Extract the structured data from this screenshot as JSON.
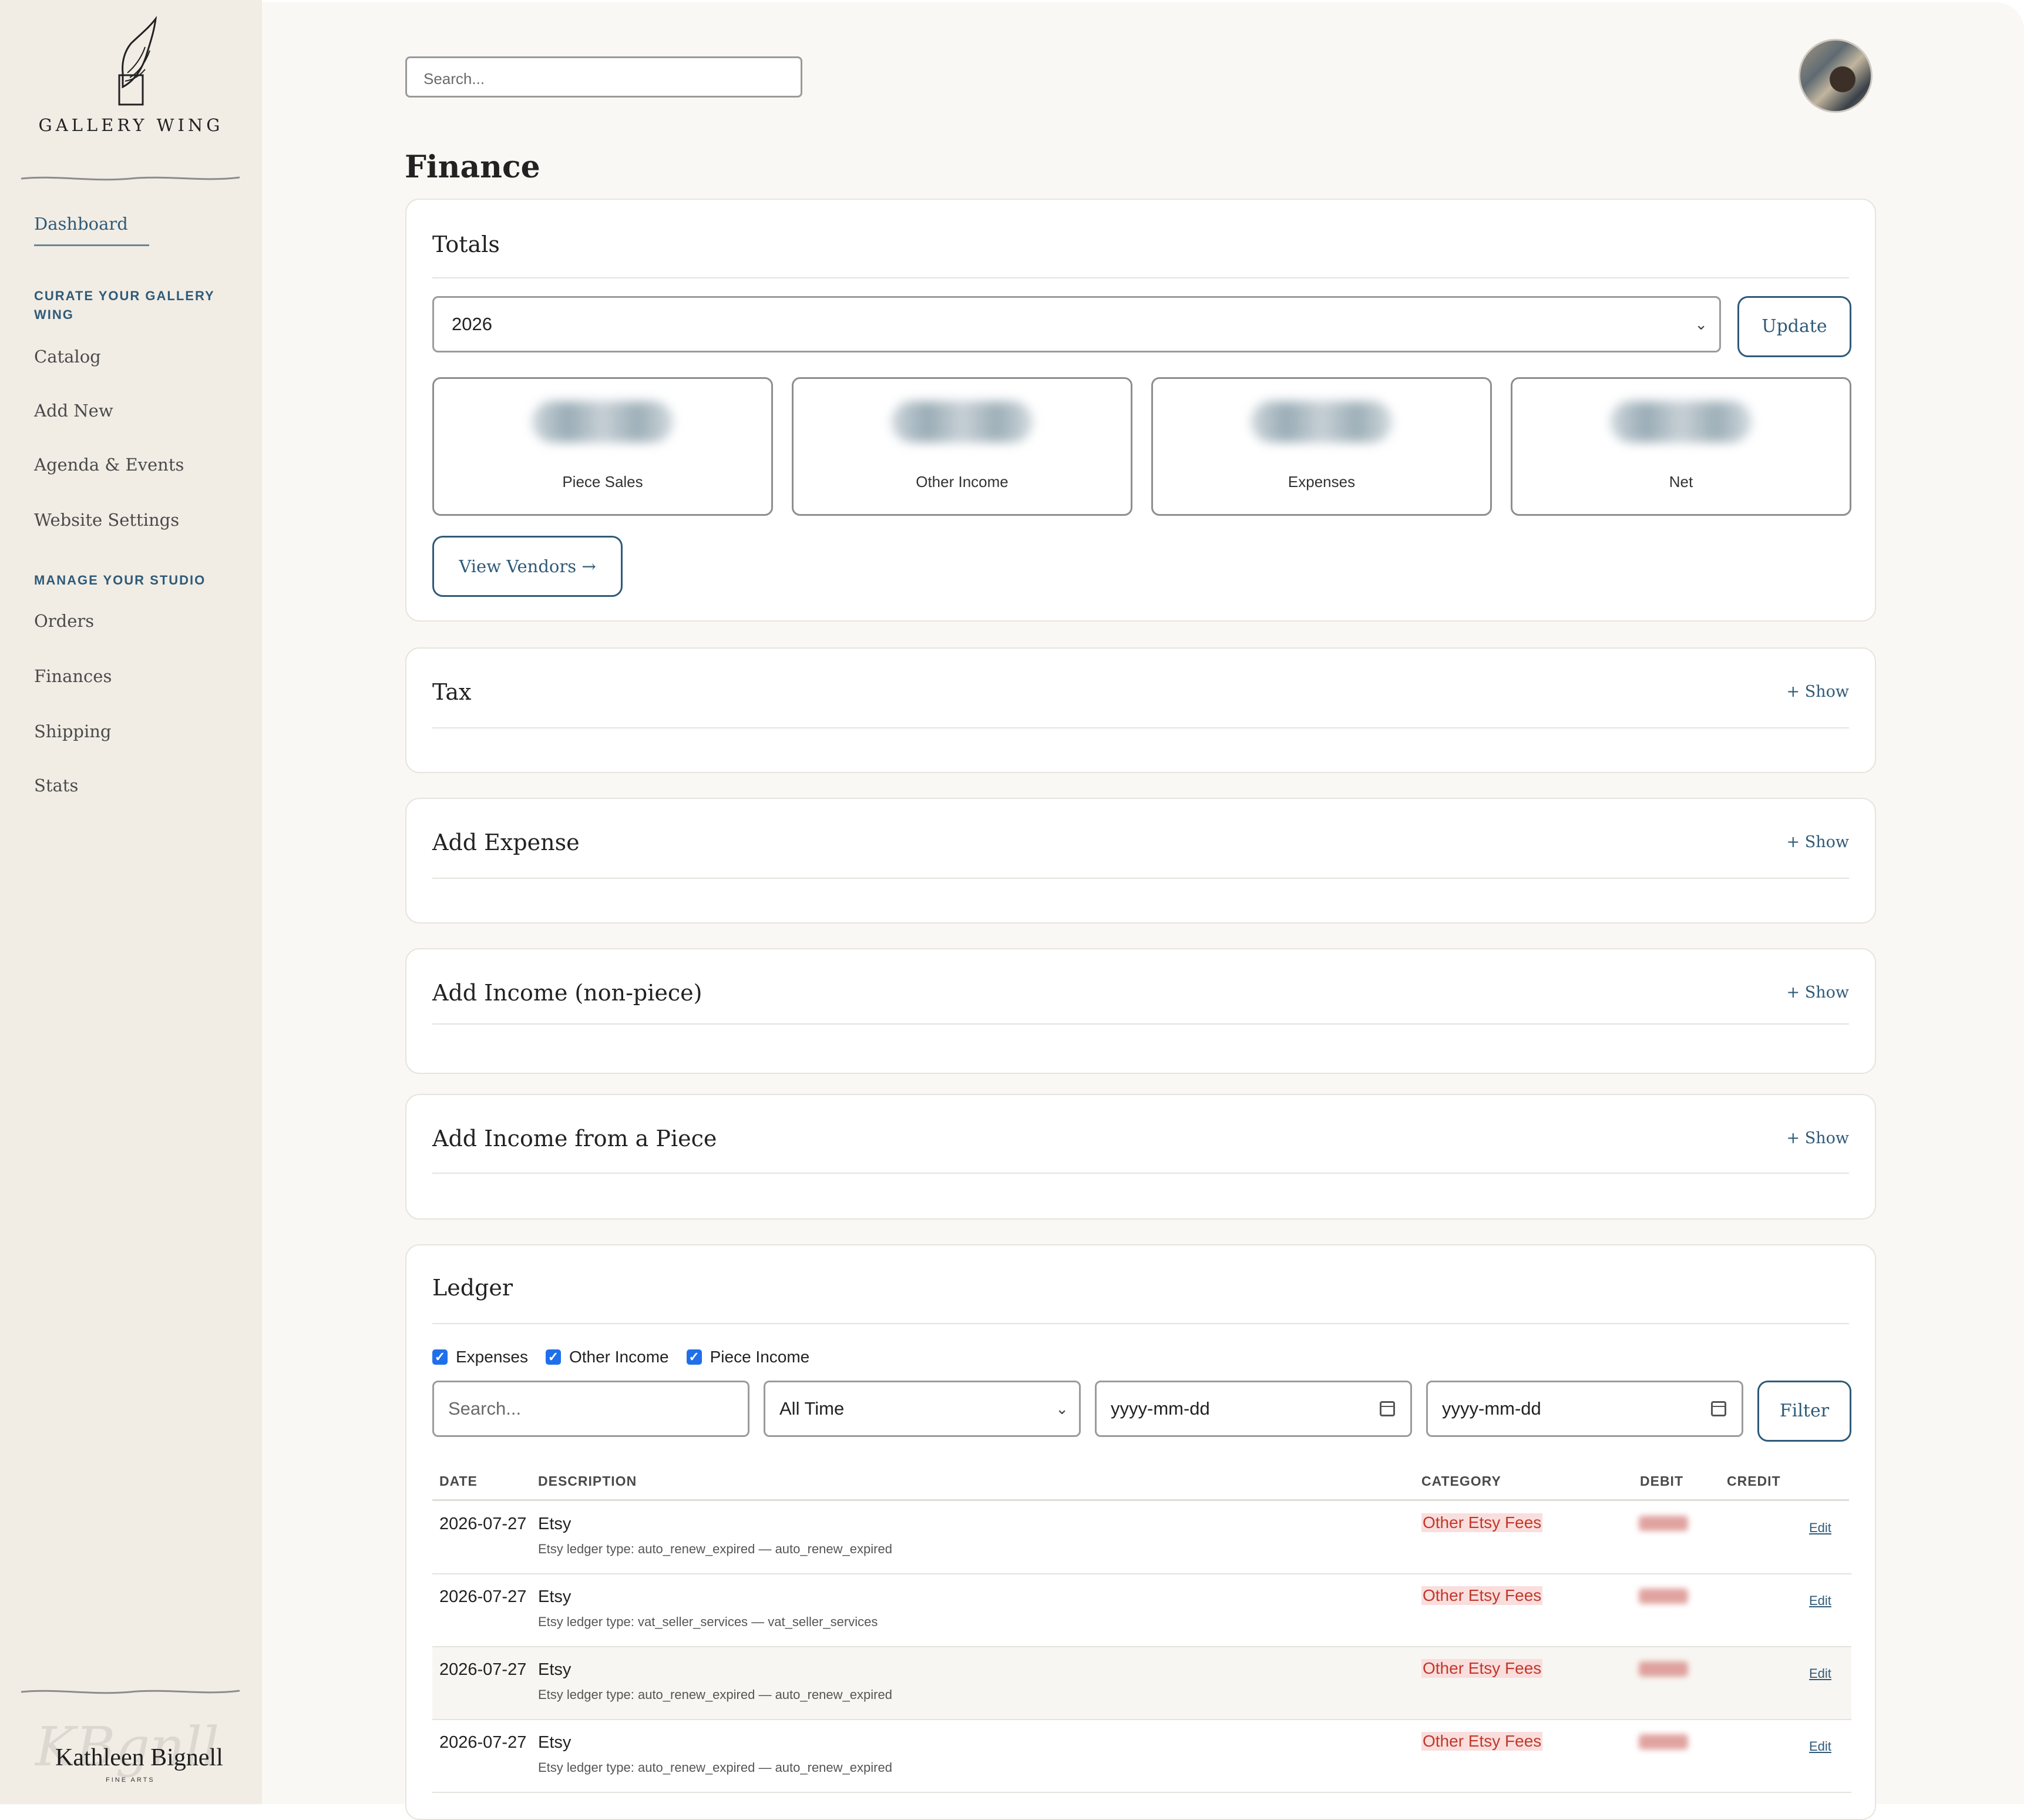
{
  "brand": {
    "name": "GALLERY WING"
  },
  "sidebar": {
    "dashboard": "Dashboard",
    "section_curate": "CURATE YOUR GALLERY WING",
    "curate_items": [
      "Catalog",
      "Add New",
      "Agenda & Events",
      "Website Settings"
    ],
    "section_manage": "MANAGE YOUR STUDIO",
    "manage_items": [
      "Orders",
      "Finances",
      "Shipping",
      "Stats"
    ],
    "footer_logo": {
      "name": "Kathleen Bignell",
      "sub": "FINE ARTS"
    }
  },
  "header": {
    "search_placeholder": "Search..."
  },
  "page": {
    "title": "Finance"
  },
  "totals": {
    "title": "Totals",
    "year": "2026",
    "update_label": "Update",
    "stats": [
      "Piece Sales",
      "Other Income",
      "Expenses",
      "Net"
    ],
    "view_vendors_label": "View Vendors →"
  },
  "sections": [
    {
      "title": "Tax",
      "toggle": "+ Show"
    },
    {
      "title": "Add Expense",
      "toggle": "+ Show"
    },
    {
      "title": "Add Income (non-piece)",
      "toggle": "+ Show"
    },
    {
      "title": "Add Income from a Piece",
      "toggle": "+ Show"
    }
  ],
  "ledger": {
    "title": "Ledger",
    "filters": {
      "checkboxes": [
        {
          "label": "Expenses",
          "checked": true
        },
        {
          "label": "Other Income",
          "checked": true
        },
        {
          "label": "Piece Income",
          "checked": true
        }
      ],
      "search_placeholder": "Search...",
      "range": "All Time",
      "date_from_placeholder": "yyyy-mm-dd",
      "date_to_placeholder": "yyyy-mm-dd",
      "filter_label": "Filter"
    },
    "columns": [
      "DATE",
      "DESCRIPTION",
      "CATEGORY",
      "DEBIT",
      "CREDIT"
    ],
    "rows": [
      {
        "date": "2026-07-27",
        "desc": "Etsy",
        "sub": "Etsy ledger type: auto_renew_expired — auto_renew_expired",
        "category": "Other Etsy Fees",
        "edit": "Edit"
      },
      {
        "date": "2026-07-27",
        "desc": "Etsy",
        "sub": "Etsy ledger type: vat_seller_services — vat_seller_services",
        "category": "Other Etsy Fees",
        "edit": "Edit"
      },
      {
        "date": "2026-07-27",
        "desc": "Etsy",
        "sub": "Etsy ledger type: auto_renew_expired — auto_renew_expired",
        "category": "Other Etsy Fees",
        "edit": "Edit"
      },
      {
        "date": "2026-07-27",
        "desc": "Etsy",
        "sub": "Etsy ledger type: auto_renew_expired — auto_renew_expired",
        "category": "Other Etsy Fees",
        "edit": "Edit"
      }
    ]
  },
  "colors": {
    "accent": "#2f5a78",
    "category_text": "#c0392b",
    "category_bg": "#f9dedd",
    "checkbox": "#1f6feb"
  }
}
